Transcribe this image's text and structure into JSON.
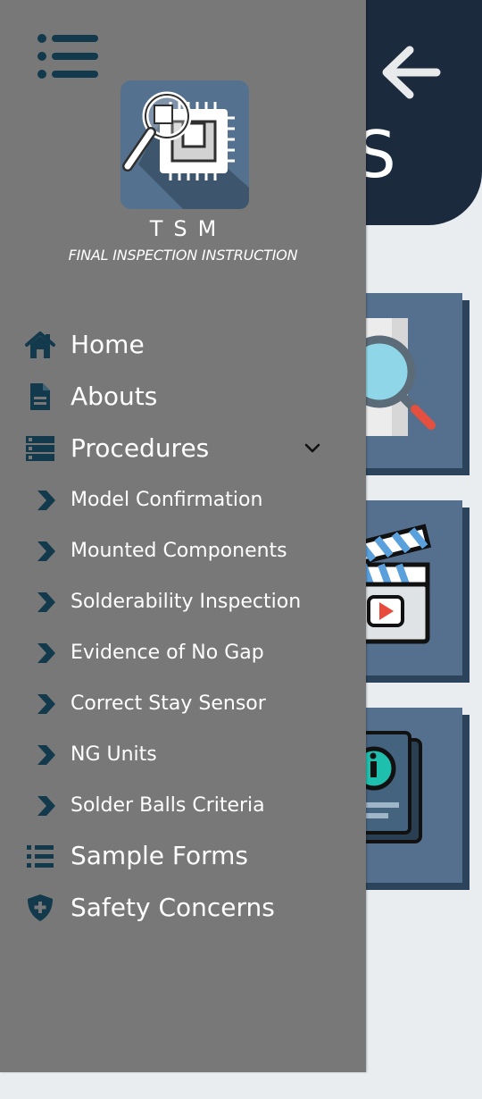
{
  "background": {
    "title_fragment": "S",
    "back_icon": "arrow-left-icon",
    "cards": [
      {
        "icon": "magnifier-document-icon"
      },
      {
        "icon": "clapperboard-video-icon"
      },
      {
        "icon": "info-book-icon"
      }
    ]
  },
  "drawer": {
    "menu_icon": "hamburger-menu-icon",
    "brand_name": "TSM",
    "brand_subtitle": "FINAL INSPECTION INSTRUCTION",
    "items": [
      {
        "label": "Home",
        "icon": "home-icon"
      },
      {
        "label": "Abouts",
        "icon": "document-icon"
      },
      {
        "label": "Procedures",
        "icon": "list-box-icon",
        "expanded": true
      },
      {
        "label": "Sample Forms",
        "icon": "list-icon"
      },
      {
        "label": "Safety Concerns",
        "icon": "shield-plus-icon"
      }
    ],
    "procedures": [
      {
        "label": "Model Confirmation"
      },
      {
        "label": "Mounted Components"
      },
      {
        "label": "Solderability Inspection"
      },
      {
        "label": "Evidence of No Gap"
      },
      {
        "label": "Correct Stay Sensor"
      },
      {
        "label": "NG Units"
      },
      {
        "label": "Solder Balls Criteria"
      }
    ]
  },
  "colors": {
    "drawer_bg": "#787878",
    "icon_dark": "#123a4c",
    "header_bg": "#1b2a3d",
    "card_bg": "#55708e",
    "screen_bg": "#e9edf0"
  }
}
